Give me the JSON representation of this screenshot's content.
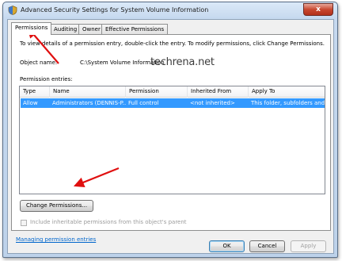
{
  "window": {
    "title": "Advanced Security Settings for System Volume Information",
    "close_glyph": "x"
  },
  "tabs": [
    {
      "label": "Permissions",
      "active": true
    },
    {
      "label": "Auditing",
      "active": false
    },
    {
      "label": "Owner",
      "active": false
    },
    {
      "label": "Effective Permissions",
      "active": false
    }
  ],
  "permissions": {
    "instructions": "To view details of a permission entry, double-click the entry. To modify permissions, click Change Permissions.",
    "object_name_label": "Object name:",
    "object_name_value": "C:\\System Volume Information",
    "watermark": "techrena.net",
    "entries_label": "Permission entries:",
    "columns": [
      "Type",
      "Name",
      "Permission",
      "Inherited From",
      "Apply To"
    ],
    "rows": [
      {
        "type": "Allow",
        "name": "Administrators (DENNIS-P...",
        "permission": "Full control",
        "inherited_from": "<not inherited>",
        "apply_to": "This folder, subfolders and...",
        "selected": true
      }
    ],
    "change_permissions_button": "Change Permissions...",
    "include_inheritable_label": "Include inheritable permissions from this object's parent",
    "include_inheritable_checked": false,
    "managing_link": "Managing permission entries"
  },
  "footer": {
    "ok_label": "OK",
    "cancel_label": "Cancel",
    "apply_label": "Apply"
  },
  "colors": {
    "selection": "#3399ff",
    "link": "#0066cc",
    "annotation_arrow": "#e01010"
  },
  "icons": [
    "shield-icon",
    "close-icon",
    "arrow-annotation"
  ]
}
